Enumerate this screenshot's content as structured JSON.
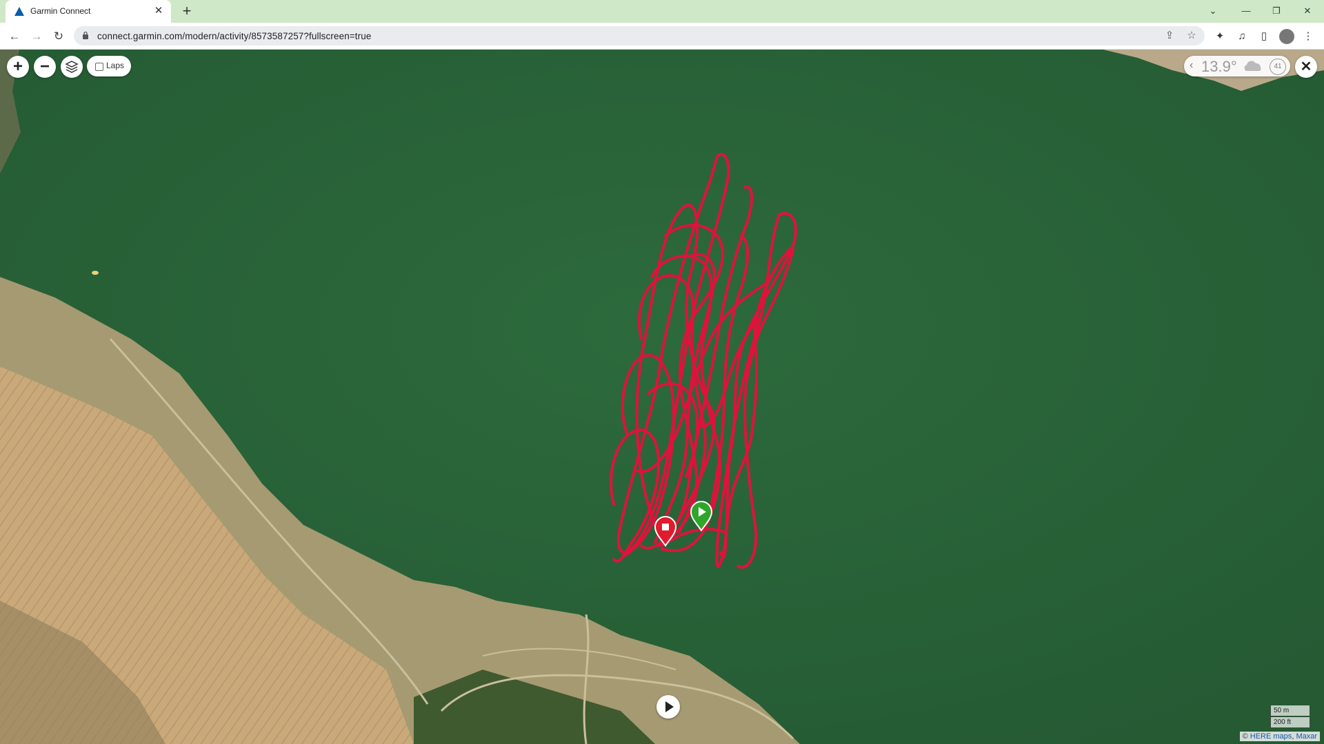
{
  "browser": {
    "tab_title": "Garmin Connect",
    "new_tab_label": "+",
    "url": "connect.garmin.com/modern/activity/8573587257?fullscreen=true"
  },
  "map_controls": {
    "zoom_in": "+",
    "zoom_out": "−",
    "laps_label": "Laps"
  },
  "weather": {
    "temperature": "13.9°",
    "wind": "41"
  },
  "scale": {
    "metric": "50 m",
    "imperial": "200 ft"
  },
  "attribution": {
    "copyright": "©",
    "here": "HERE maps",
    "separator": ",",
    "maxar": "Maxar"
  },
  "colors": {
    "track": "#e0123c",
    "water": "#2b6438",
    "field": "#c8a878",
    "start_marker": "#2fa52a",
    "end_marker": "#e01b2b",
    "tab_bar": "#cfe8c8"
  },
  "icons": [
    "garmin-logo-icon",
    "close-icon",
    "back-icon",
    "forward-icon",
    "reload-icon",
    "lock-icon",
    "share-icon",
    "star-icon",
    "extensions-icon",
    "media-icon",
    "sidepanel-icon",
    "menu-icon",
    "layers-icon",
    "cloud-icon",
    "play-icon",
    "start-flag-icon",
    "finish-flag-icon"
  ]
}
